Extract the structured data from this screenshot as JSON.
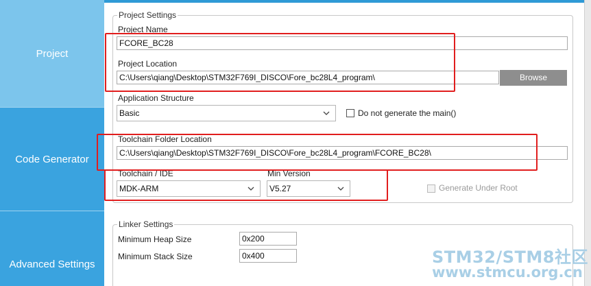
{
  "sidebar": {
    "items": [
      {
        "label": "Project"
      },
      {
        "label": "Code Generator"
      },
      {
        "label": "Advanced Settings"
      }
    ]
  },
  "project_settings": {
    "title": "Project Settings",
    "project_name_label": "Project Name",
    "project_name_value": "FCORE_BC28",
    "project_location_label": "Project Location",
    "project_location_value": "C:\\Users\\qiang\\Desktop\\STM32F769I_DISCO\\Fore_bc28L4_program\\",
    "browse_label": "Browse",
    "app_structure_label": "Application Structure",
    "app_structure_value": "Basic",
    "no_main_label": "Do not generate the main()",
    "toolchain_folder_label": "Toolchain Folder Location",
    "toolchain_folder_value": "C:\\Users\\qiang\\Desktop\\STM32F769I_DISCO\\Fore_bc28L4_program\\FCORE_BC28\\",
    "toolchain_ide_label": "Toolchain / IDE",
    "toolchain_ide_value": "MDK-ARM",
    "min_version_label": "Min Version",
    "min_version_value": "V5.27",
    "generate_under_root_label": "Generate Under Root"
  },
  "linker_settings": {
    "title": "Linker Settings",
    "heap_label": "Minimum Heap Size",
    "heap_value": "0x200",
    "stack_label": "Minimum Stack Size",
    "stack_value": "0x400"
  },
  "watermark": {
    "line1": "STM32/STM8社区",
    "line2": "www.stmcu.org.cn"
  },
  "colors": {
    "sidebar": "#2f9ad6",
    "sidebar_selected": "#7cc5ec",
    "highlight_box": "#e11d1d",
    "button": "#8e8e8e"
  },
  "icons": [
    "chevron-down-icon",
    "checkbox-icon"
  ]
}
